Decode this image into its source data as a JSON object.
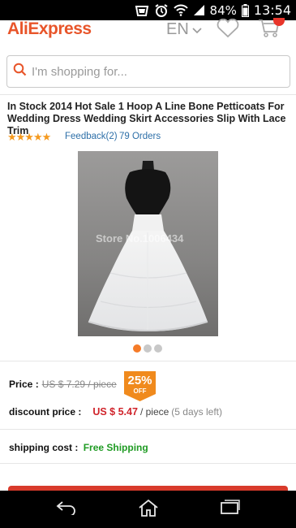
{
  "status_bar": {
    "battery": "84%",
    "time": "13:54",
    "icons": [
      "signal-strength-icon",
      "alarm-icon",
      "wifi-icon",
      "cell-signal-icon",
      "battery-icon"
    ]
  },
  "header": {
    "logo": "AliExpress",
    "language": "EN",
    "icons": [
      "heart-icon",
      "cart-icon"
    ]
  },
  "search": {
    "placeholder": "I'm shopping for..."
  },
  "product": {
    "title": "In Stock 2014 Hot Sale 1 Hoop A Line Bone Petticoats For Wedding Dress Wedding Skirt Accessories Slip With Lace Trim",
    "stars": "★★★★★",
    "rating": 5,
    "feedback": "Feedback(2)",
    "orders": "79 Orders",
    "image_watermark": "Store No.1006434",
    "gallery_count": 3,
    "gallery_active_index": 0
  },
  "pricing": {
    "price_label": "Price :",
    "old_price": "US $ 7.29 / piece",
    "discount_percent": "25%",
    "discount_off": "OFF",
    "discount_label": "discount price :",
    "discount_price": "US $ 5.47",
    "unit": "/ piece",
    "days_left": "(5 days left)"
  },
  "shipping": {
    "label": "shipping cost :",
    "value": "Free Shipping"
  },
  "colors": {
    "brand": "#e8552a",
    "star": "#f59a1f",
    "link": "#2d6fa8",
    "discount_price": "#d0242b",
    "free_shipping": "#1f9b23",
    "active_dot": "#f57b28"
  },
  "nav_bar": {
    "icons": [
      "back-icon",
      "home-icon",
      "recent-apps-icon"
    ]
  }
}
